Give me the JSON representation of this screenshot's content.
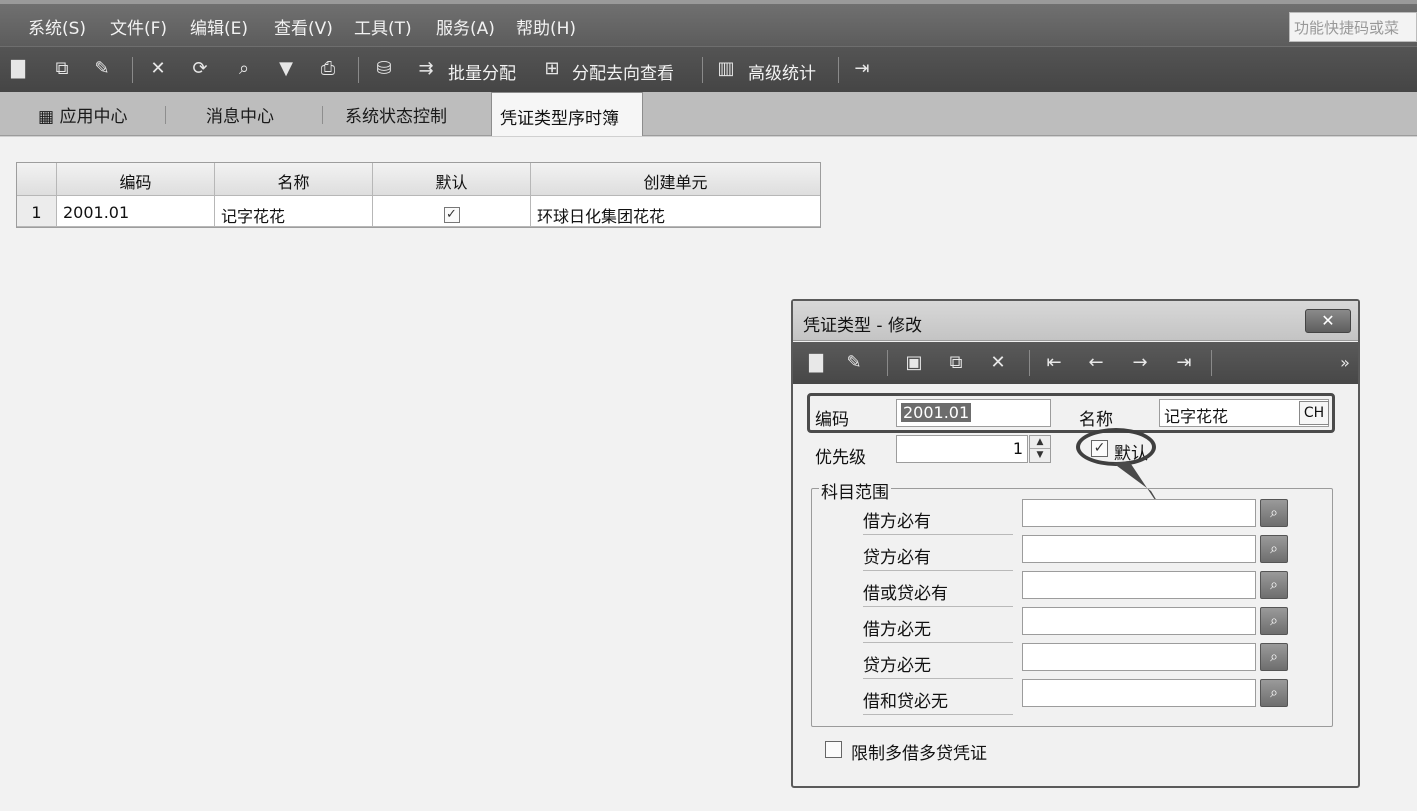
{
  "menu": {
    "items": [
      "系统(S)",
      "文件(F)",
      "编辑(E)",
      "查看(V)",
      "工具(T)",
      "服务(A)",
      "帮助(H)"
    ],
    "quick_search": "功能快捷码或菜"
  },
  "toolbar": {
    "icons": [
      "new-icon",
      "binoculars-icon",
      "edit-icon",
      "delete-icon",
      "refresh-icon",
      "locate-icon",
      "filter-icon",
      "print-icon",
      "assign-icon"
    ],
    "batch_assign": "批量分配",
    "assign_view": "分配去向查看",
    "advanced_stats": "高级统计"
  },
  "tabs": {
    "app_center": "应用中心",
    "message_center": "消息中心",
    "system_status": "系统状态控制",
    "active": "凭证类型序时簿"
  },
  "grid": {
    "headers": [
      "编码",
      "名称",
      "默认",
      "创建单元"
    ],
    "rows": [
      {
        "index": "1",
        "code": "2001.01",
        "name": "记字花花",
        "default_mark": "✓",
        "unit": "环球日化集团花花"
      }
    ]
  },
  "dialog": {
    "title": "凭证类型 - 修改",
    "close": "✕",
    "more": "»",
    "code_label": "编码",
    "code_value": "2001.01",
    "name_label": "名称",
    "name_value": "记字花花",
    "ch_button": "CH",
    "priority_label": "优先级",
    "priority_value": "1",
    "default_label": "默认",
    "default_mark": "✓",
    "group_title": "科目范围",
    "ranges": [
      "借方必有",
      "贷方必有",
      "借或贷必有",
      "借方必无",
      "贷方必无",
      "借和贷必无"
    ],
    "limit_label": "限制多借多贷凭证"
  }
}
